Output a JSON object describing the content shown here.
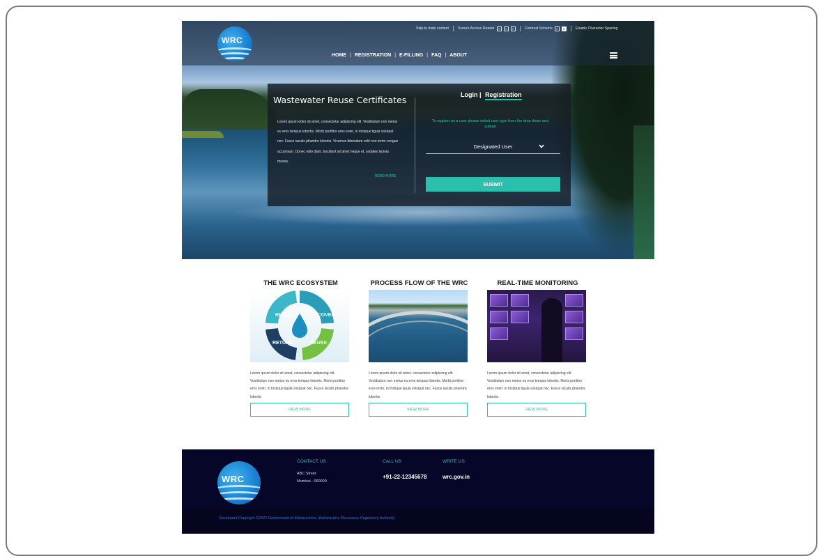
{
  "logo": {
    "text": "WRC"
  },
  "accessibility": {
    "skip": "Skip to main content",
    "screen_reader": "Screen Access Reader",
    "contrast": "Contrast Scheme",
    "spacing": "Enable Character Spacing"
  },
  "nav": {
    "items": [
      "HOME",
      "REGISTRATION",
      "E-FILLING",
      "FAQ",
      "ABOUT"
    ],
    "separator": "|"
  },
  "hero": {
    "title": "Wastewater Reuse Certificates",
    "body": "Lorem ipsum dolor sit amet, consectetur adipiscing elit. Vestibulum non metus eu eros tempus lobortis. Morbi porttitor eros enim, in tristique ligula volutpat nec. Fusce iaculis pharetra lobortis. Vivamus bibendum velit non tortor congue accumsan. Donec odio diam, tincidunt sit amet neque et, sodales lacinia massa.",
    "read_more": "READ MORE",
    "tab_login": "Login",
    "tab_sep": "|",
    "tab_registration": "Registration",
    "hint": "To register as a user please select user type from the drop down and submit",
    "select_value": "Designated User",
    "submit": "SUBMIT"
  },
  "features": [
    {
      "title": "THE WRC ECOSYSTEM",
      "text": "Lorem ipsum dolor sit amet, consectetur adipiscing elit. Vestibulum non metus eu eros tempus lobortis. Morbi porttitor eros enim, in tristique ligula volutpat nec. Fusce iaculis pharetra lobortis",
      "button": "VIEW MORE",
      "labels": [
        "REDUCE",
        "RECOVER",
        "REUSE",
        "RETURN"
      ]
    },
    {
      "title": "PROCESS FLOW OF THE WRC",
      "text": "Lorem ipsum dolor sit amet, consectetur adipiscing elit. Vestibulum non metus eu eros tempus lobortis. Morbi porttitor eros enim, in tristique ligula volutpat nec. Fusce iaculis pharetra lobortis",
      "button": "VIEW MORE"
    },
    {
      "title": "REAL-TIME MONITORING",
      "text": "Lorem ipsum dolor sit amet, consectetur adipiscing elit. Vestibulum non metus eu eros tempus lobortis. Morbi porttitor eros enim, in tristique ligula volutpat nec. Fusce iaculis pharetra lobortis",
      "button": "VIEW MORE"
    }
  ],
  "footer": {
    "contact_title": "CONTACT US",
    "address_line1": "ABC Street",
    "address_line2": "Mumbai - 000000",
    "call_title": "CALL US",
    "phone": "+91-22-12345678",
    "write_title": "WRITE US",
    "website": "wrc.gov.in",
    "copyright": "Developed Copyright ©2020 Government of Maharashtra, Maharashtra Resources Regulatory Authority"
  },
  "colors": {
    "accent": "#2bbfad",
    "footer_bg": "#060628",
    "copyright": "#2f73c9"
  }
}
